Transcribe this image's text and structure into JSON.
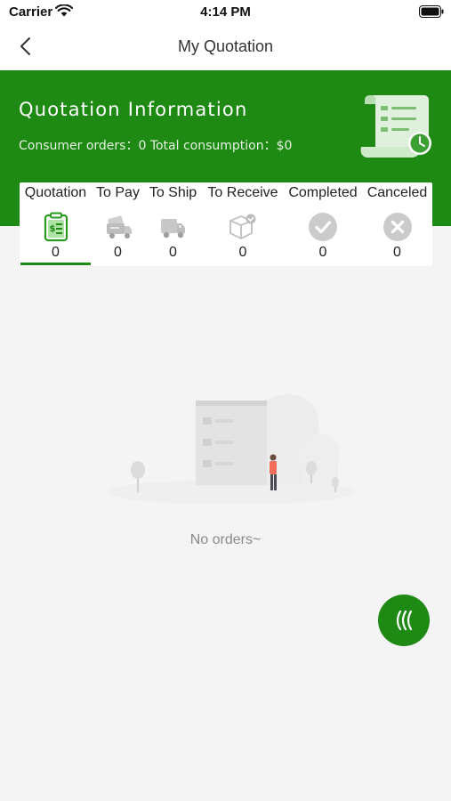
{
  "status_bar": {
    "carrier": "Carrier",
    "time": "4:14 PM"
  },
  "nav": {
    "title": "My Quotation",
    "back_icon": "chevron-left-icon"
  },
  "header": {
    "title": "Quotation Information",
    "subtitle": "Consumer orders：0 Total consumption：$0",
    "background_color": "#1e8a14",
    "illustration_icon": "receipt-clock-icon"
  },
  "tabs": [
    {
      "label": "Quotation",
      "count": "0",
      "icon": "clipboard-dollar-icon",
      "active": true
    },
    {
      "label": "To Pay",
      "count": "0",
      "icon": "wallet-truck-icon",
      "active": false
    },
    {
      "label": "To Ship",
      "count": "0",
      "icon": "truck-icon",
      "active": false
    },
    {
      "label": "To Receive",
      "count": "0",
      "icon": "package-check-icon",
      "active": false
    },
    {
      "label": "Completed",
      "count": "0",
      "icon": "check-circle-icon",
      "active": false
    },
    {
      "label": "Canceled",
      "count": "0",
      "icon": "x-circle-icon",
      "active": false
    }
  ],
  "empty_state": {
    "message": "No orders~",
    "illustration": "empty-building-illustration"
  },
  "fab": {
    "icon": "chevrons-left-icon",
    "color": "#1e8a14"
  },
  "colors": {
    "accent": "#1e8a14",
    "inactive_icon": "#c8c8c8"
  }
}
